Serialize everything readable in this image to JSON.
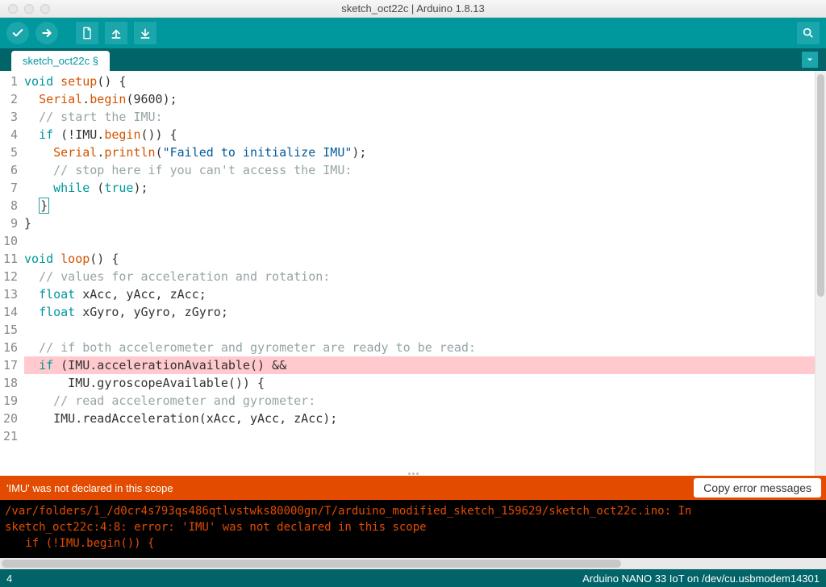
{
  "window": {
    "title": "sketch_oct22c | Arduino 1.8.13"
  },
  "tab": {
    "label": "sketch_oct22c §"
  },
  "code_lines": [
    {
      "n": 1,
      "hl": false,
      "tokens": [
        [
          "kw",
          "void"
        ],
        [
          "",
          " "
        ],
        [
          "id1",
          "setup"
        ],
        [
          "",
          "() {"
        ]
      ]
    },
    {
      "n": 2,
      "hl": false,
      "tokens": [
        [
          "",
          "  "
        ],
        [
          "id1",
          "Serial"
        ],
        [
          "",
          "."
        ],
        [
          "id1",
          "begin"
        ],
        [
          "",
          "(9600);"
        ]
      ]
    },
    {
      "n": 3,
      "hl": false,
      "tokens": [
        [
          "",
          "  "
        ],
        [
          "com",
          "// start the IMU:"
        ]
      ]
    },
    {
      "n": 4,
      "hl": false,
      "tokens": [
        [
          "",
          "  "
        ],
        [
          "kw",
          "if"
        ],
        [
          "",
          " (!IMU."
        ],
        [
          "id1",
          "begin"
        ],
        [
          "",
          "()) {"
        ]
      ]
    },
    {
      "n": 5,
      "hl": false,
      "tokens": [
        [
          "",
          "    "
        ],
        [
          "id1",
          "Serial"
        ],
        [
          "",
          "."
        ],
        [
          "id1",
          "println"
        ],
        [
          "",
          "("
        ],
        [
          "str",
          "\"Failed to initialize IMU\""
        ],
        [
          "",
          ");"
        ]
      ]
    },
    {
      "n": 6,
      "hl": false,
      "tokens": [
        [
          "",
          "    "
        ],
        [
          "com",
          "// stop here if you can't access the IMU:"
        ]
      ]
    },
    {
      "n": 7,
      "hl": false,
      "tokens": [
        [
          "",
          "    "
        ],
        [
          "kw",
          "while"
        ],
        [
          "",
          " ("
        ],
        [
          "bool",
          "true"
        ],
        [
          "",
          ");"
        ]
      ]
    },
    {
      "n": 8,
      "hl": false,
      "tokens": [
        [
          "",
          "  "
        ],
        [
          "cursor",
          "}"
        ]
      ]
    },
    {
      "n": 9,
      "hl": false,
      "tokens": [
        [
          "",
          "}"
        ]
      ]
    },
    {
      "n": 10,
      "hl": false,
      "tokens": [
        [
          "",
          ""
        ]
      ]
    },
    {
      "n": 11,
      "hl": false,
      "tokens": [
        [
          "kw",
          "void"
        ],
        [
          "",
          " "
        ],
        [
          "id1",
          "loop"
        ],
        [
          "",
          "() {"
        ]
      ]
    },
    {
      "n": 12,
      "hl": false,
      "tokens": [
        [
          "",
          "  "
        ],
        [
          "com",
          "// values for acceleration and rotation:"
        ]
      ]
    },
    {
      "n": 13,
      "hl": false,
      "tokens": [
        [
          "",
          "  "
        ],
        [
          "kw",
          "float"
        ],
        [
          "",
          " xAcc, yAcc, zAcc;"
        ]
      ]
    },
    {
      "n": 14,
      "hl": false,
      "tokens": [
        [
          "",
          "  "
        ],
        [
          "kw",
          "float"
        ],
        [
          "",
          " xGyro, yGyro, zGyro;"
        ]
      ]
    },
    {
      "n": 15,
      "hl": false,
      "tokens": [
        [
          "",
          ""
        ]
      ]
    },
    {
      "n": 16,
      "hl": false,
      "tokens": [
        [
          "",
          "  "
        ],
        [
          "com",
          "// if both accelerometer and gyrometer are ready to be read:"
        ]
      ]
    },
    {
      "n": 17,
      "hl": true,
      "tokens": [
        [
          "",
          "  "
        ],
        [
          "kw",
          "if"
        ],
        [
          "",
          " (IMU.accelerationAvailable() &&"
        ]
      ]
    },
    {
      "n": 18,
      "hl": false,
      "tokens": [
        [
          "",
          "      IMU.gyroscopeAvailable()) {"
        ]
      ]
    },
    {
      "n": 19,
      "hl": false,
      "tokens": [
        [
          "",
          "    "
        ],
        [
          "com",
          "// read accelerometer and gyrometer:"
        ]
      ]
    },
    {
      "n": 20,
      "hl": false,
      "tokens": [
        [
          "",
          "    IMU.readAcceleration(xAcc, yAcc, zAcc);"
        ]
      ]
    },
    {
      "n": 21,
      "hl": false,
      "tokens": [
        [
          "",
          ""
        ]
      ]
    }
  ],
  "error_bar": {
    "message": "'IMU' was not declared in this scope",
    "copy_label": "Copy error messages"
  },
  "console_lines": [
    "/var/folders/1_/d0cr4s793qs486qtlvstwks80000gn/T/arduino_modified_sketch_159629/sketch_oct22c.ino: In",
    "sketch_oct22c:4:8: error: 'IMU' was not declared in this scope",
    "   if (!IMU.begin()) {"
  ],
  "status": {
    "cursor_line": "4",
    "board": "Arduino NANO 33 IoT on /dev/cu.usbmodem14301"
  }
}
